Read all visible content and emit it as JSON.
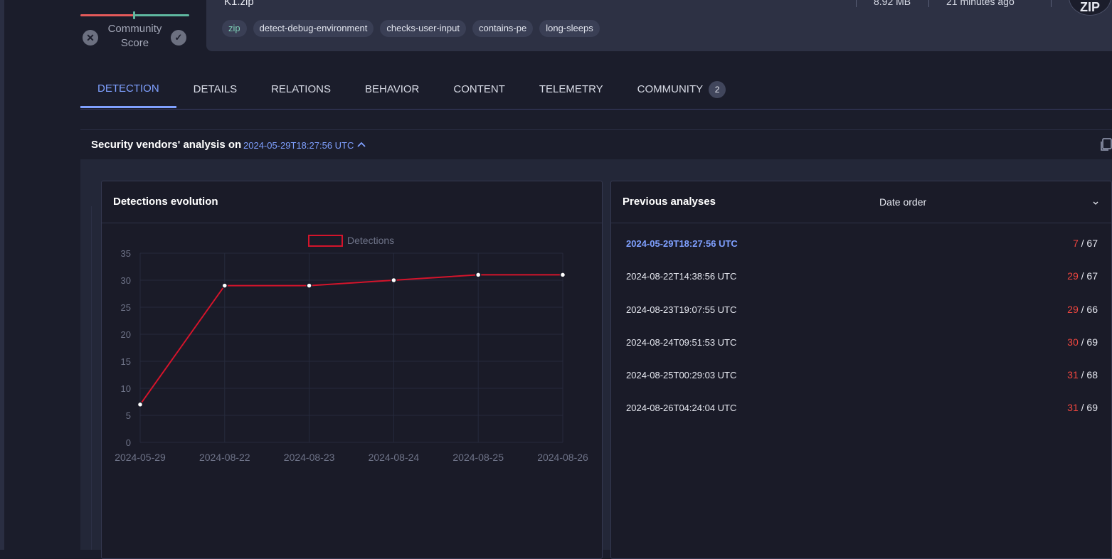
{
  "community_score": {
    "label_line1": "Community",
    "label_line2": "Score"
  },
  "file": {
    "name": "K1.zip",
    "tags": [
      "zip",
      "detect-debug-environment",
      "checks-user-input",
      "contains-pe",
      "long-sleeps"
    ],
    "size": "8.92 MB",
    "last_seen": "21 minutes ago",
    "type_badge": "ZIP"
  },
  "tabs": [
    {
      "label": "DETECTION",
      "active": true
    },
    {
      "label": "DETAILS"
    },
    {
      "label": "RELATIONS"
    },
    {
      "label": "BEHAVIOR"
    },
    {
      "label": "CONTENT"
    },
    {
      "label": "TELEMETRY"
    },
    {
      "label": "COMMUNITY",
      "count": "2"
    }
  ],
  "section": {
    "title": "Security vendors' analysis on",
    "date": "2024-05-29T18:27:56 UTC"
  },
  "evolution_panel": {
    "title": "Detections evolution"
  },
  "chart_data": {
    "type": "line",
    "title": "",
    "xlabel": "",
    "ylabel": "",
    "categories": [
      "2024-05-29",
      "2024-08-22",
      "2024-08-23",
      "2024-08-24",
      "2024-08-25",
      "2024-08-26"
    ],
    "series": [
      {
        "name": "Detections",
        "values": [
          7,
          29,
          29,
          30,
          31,
          31
        ],
        "color": "#d4142b"
      }
    ],
    "ylim": [
      0,
      35
    ],
    "yticks": [
      0,
      5,
      10,
      15,
      20,
      25,
      30,
      35
    ],
    "grid": true,
    "legend": "top-center"
  },
  "previous_panel": {
    "title": "Previous analyses",
    "order_label": "Date order",
    "analyses": [
      {
        "date": "2024-05-29T18:27:56 UTC",
        "detected": "7",
        "total": "/ 67",
        "current": true
      },
      {
        "date": "2024-08-22T14:38:56 UTC",
        "detected": "29",
        "total": "/ 67"
      },
      {
        "date": "2024-08-23T19:07:55 UTC",
        "detected": "29",
        "total": "/ 66"
      },
      {
        "date": "2024-08-24T09:51:53 UTC",
        "detected": "30",
        "total": "/ 69"
      },
      {
        "date": "2024-08-25T00:29:03 UTC",
        "detected": "31",
        "total": "/ 68"
      },
      {
        "date": "2024-08-26T04:24:04 UTC",
        "detected": "31",
        "total": "/ 69"
      }
    ]
  },
  "colors": {
    "accent": "#7fa0ff",
    "detection": "#f0463f",
    "background": "#1b1d2b"
  }
}
